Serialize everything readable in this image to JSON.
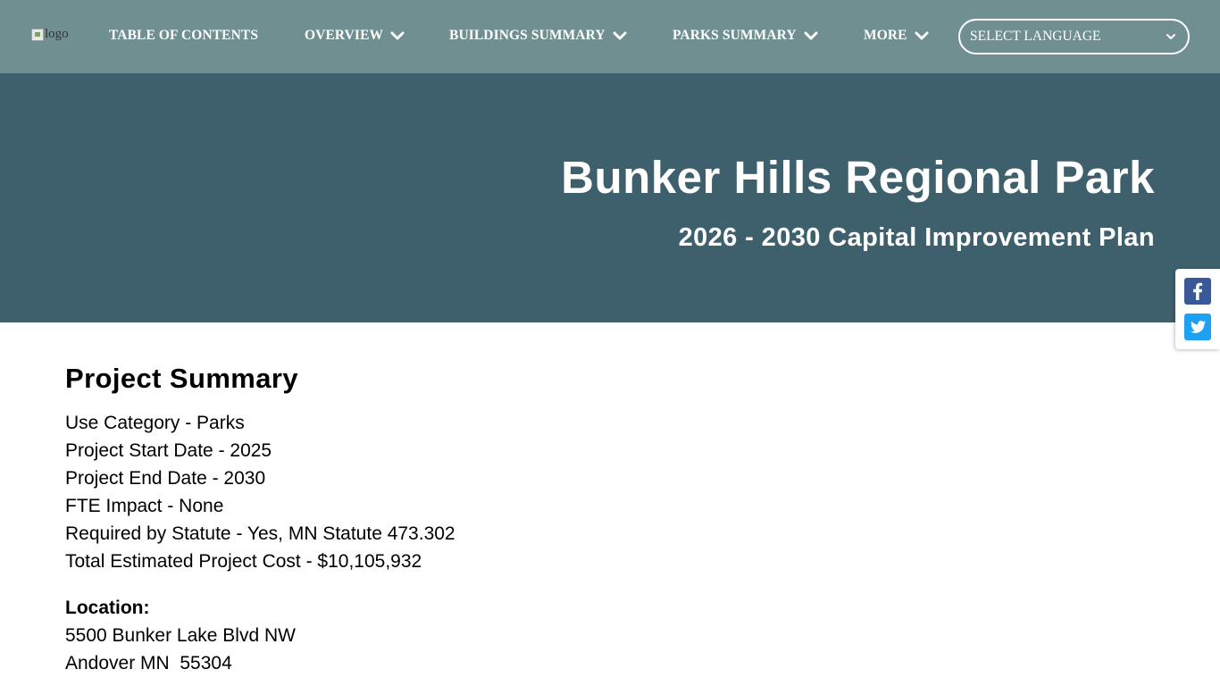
{
  "nav": {
    "logo_alt": "logo",
    "items": [
      {
        "label": "TABLE OF CONTENTS",
        "has_dropdown": false
      },
      {
        "label": "OVERVIEW",
        "has_dropdown": true
      },
      {
        "label": "BUILDINGS SUMMARY",
        "has_dropdown": true
      },
      {
        "label": "PARKS SUMMARY",
        "has_dropdown": true
      },
      {
        "label": "MORE",
        "has_dropdown": true
      }
    ],
    "language_select": "SELECT LANGUAGE"
  },
  "hero": {
    "title": "Bunker Hills Regional Park",
    "subtitle": "2026 - 2030 Capital Improvement Plan"
  },
  "share": {
    "icons": [
      "facebook-icon",
      "twitter-icon"
    ]
  },
  "content": {
    "heading": "Project Summary",
    "summary_lines": [
      "Use Category - Parks",
      "Project Start Date - 2025",
      "Project End Date - 2030",
      "FTE Impact - None",
      "Required by Statute - Yes, MN Statute 473.302",
      "Total Estimated Project Cost - $10,105,932"
    ],
    "location_heading": "Location:",
    "location_lines": [
      "5500 Bunker Lake Blvd NW",
      "Andover MN  55304"
    ]
  },
  "colors": {
    "nav_bg": "#6f8f90",
    "hero_bg": "#3d606c",
    "facebook": "#3b5998",
    "twitter": "#1da1f2"
  }
}
